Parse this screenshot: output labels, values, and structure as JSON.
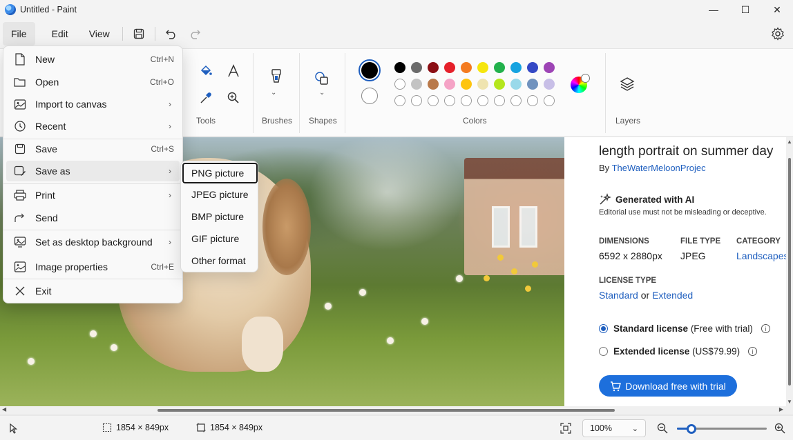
{
  "window": {
    "title": "Untitled - Paint",
    "minimize": "—",
    "maximize": "☐",
    "close": "✕"
  },
  "menubar": {
    "file": "File",
    "edit": "Edit",
    "view": "View"
  },
  "ribbon": {
    "groups": {
      "tools": "Tools",
      "brushes": "Brushes",
      "shapes": "Shapes",
      "colors": "Colors",
      "layers": "Layers"
    },
    "palette_row1": [
      "#000000",
      "#6b6b6b",
      "#8b0e14",
      "#e5202a",
      "#f47b20",
      "#f6e60d",
      "#22b14c",
      "#16a3e0",
      "#3448c5",
      "#9d44b5"
    ],
    "palette_row2": [
      "#ffffff",
      "#c3c3c3",
      "#b9794a",
      "#f5a3c6",
      "#fec40e",
      "#efe4b0",
      "#b5e61d",
      "#99d9ea",
      "#7092be",
      "#c8bfe7"
    ],
    "color1": "#000000",
    "color2": "#ffffff"
  },
  "file_menu": {
    "items": [
      {
        "label": "New",
        "shortcut": "Ctrl+N"
      },
      {
        "label": "Open",
        "shortcut": "Ctrl+O"
      },
      {
        "label": "Import to canvas",
        "shortcut": ""
      },
      {
        "label": "Recent",
        "shortcut": ""
      },
      {
        "label": "Save",
        "shortcut": "Ctrl+S"
      },
      {
        "label": "Save as",
        "shortcut": ""
      },
      {
        "label": "Print",
        "shortcut": ""
      },
      {
        "label": "Send",
        "shortcut": ""
      },
      {
        "label": "Set as desktop background",
        "shortcut": ""
      },
      {
        "label": "Image properties",
        "shortcut": "Ctrl+E"
      },
      {
        "label": "Exit",
        "shortcut": ""
      }
    ]
  },
  "save_as_menu": {
    "items": [
      "PNG picture",
      "JPEG picture",
      "BMP picture",
      "GIF picture",
      "Other format"
    ]
  },
  "panel": {
    "title": "length portrait on summer day",
    "by_prefix": "By",
    "author": "TheWaterMeloonProjec",
    "ai_title": "Generated with AI",
    "ai_sub": "Editorial use must not be misleading or deceptive.",
    "dimensions_label": "DIMENSIONS",
    "dimensions_value": "6592 x 2880px",
    "filetype_label": "FILE TYPE",
    "filetype_value": "JPEG",
    "category_label": "CATEGORY",
    "category_value": "Landscapes",
    "license_label": "LICENSE TYPE",
    "license_standard": "Standard",
    "license_or": "or",
    "license_extended": "Extended",
    "std_license": "Standard license",
    "std_note": "(Free with trial)",
    "ext_license": "Extended license",
    "ext_note": "(US$79.99)",
    "download": "Download free with trial",
    "info_glyph": "i"
  },
  "status": {
    "selection_size": "1854 × 849px",
    "canvas_size": "1854 × 849px",
    "zoom": "100%",
    "zoom_level": 0.16
  }
}
